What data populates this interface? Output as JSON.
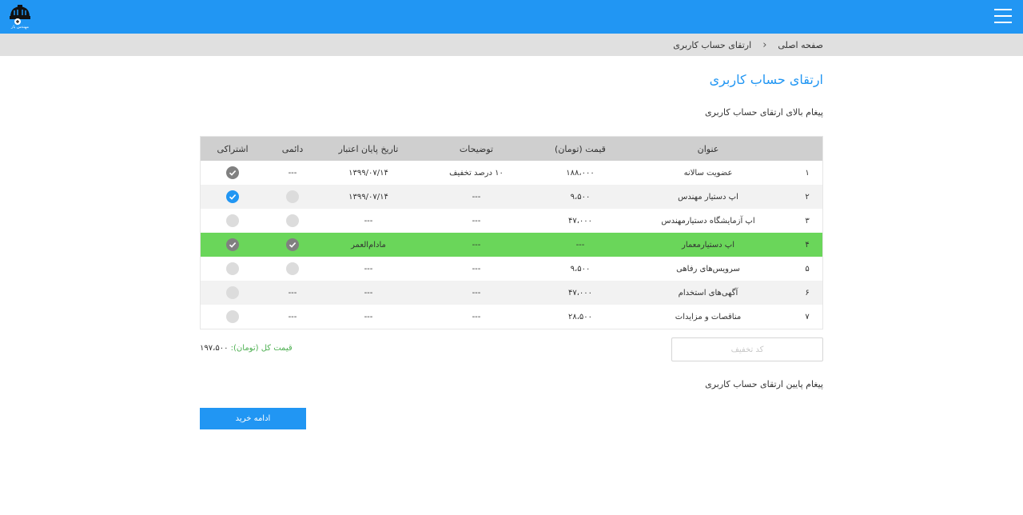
{
  "header": {
    "logo_text": "مهندس یار",
    "menu_icon": "hamburger-icon",
    "accent_color": "#2196f3"
  },
  "breadcrumb": {
    "home": "صفحه اصلی",
    "current": "ارتقای حساب کاربری"
  },
  "page": {
    "title": "ارتقای حساب کاربری",
    "top_message": "پیغام بالای ارتقای حساب کاربری",
    "bottom_message": "پیغام پایین ارتقای حساب کاربری"
  },
  "table": {
    "headers": {
      "title": "عنوان",
      "price": "قیمت (تومان)",
      "desc": "توضیحات",
      "date": "تاریخ پایان اعتبار",
      "permanent": "دائمی",
      "subscription": "اشتراکی"
    },
    "rows": [
      {
        "num": "۱",
        "title": "عضویت سالانه",
        "price": "۱۸۸،۰۰۰",
        "desc": "۱۰ درصد تخفیف",
        "date": "۱۳۹۹/۰۷/۱۴",
        "permanent": "---",
        "subscription": "checked-gray",
        "active": false
      },
      {
        "num": "۲",
        "title": "اپ دستیار مهندس",
        "price": "۹،۵۰۰",
        "desc": "---",
        "date": "۱۳۹۹/۰۷/۱۴",
        "permanent": "off",
        "subscription": "checked-blue",
        "active": false
      },
      {
        "num": "۳",
        "title": "اپ آزمایشگاه دستیارمهندس",
        "price": "۴۷،۰۰۰",
        "desc": "---",
        "date": "---",
        "permanent": "off",
        "subscription": "off",
        "active": false
      },
      {
        "num": "۴",
        "title": "اپ دستیارمعمار",
        "price": "---",
        "desc": "---",
        "date": "مادام‌العمر",
        "permanent": "checked-gray",
        "subscription": "checked-gray",
        "active": true
      },
      {
        "num": "۵",
        "title": "سرویس‌های رفاهی",
        "price": "۹،۵۰۰",
        "desc": "---",
        "date": "---",
        "permanent": "off",
        "subscription": "off",
        "active": false
      },
      {
        "num": "۶",
        "title": "آگهی‌های استخدام",
        "price": "۴۷،۰۰۰",
        "desc": "---",
        "date": "---",
        "permanent": "---",
        "subscription": "off",
        "active": false
      },
      {
        "num": "۷",
        "title": "مناقصات و مزایدات",
        "price": "۲۸،۵۰۰",
        "desc": "---",
        "date": "---",
        "permanent": "---",
        "subscription": "off",
        "active": false
      }
    ]
  },
  "discount": {
    "placeholder": "کد تخفیف",
    "value": ""
  },
  "total": {
    "label": "قیمت کل (تومان):",
    "value": "۱۹۷،۵۰۰"
  },
  "actions": {
    "continue_label": "ادامه خرید"
  },
  "colors": {
    "active_row": "#6ad65a",
    "checked_blue": "#2196f3",
    "checked_gray": "#808080",
    "unchecked": "#dcdcdc",
    "total_label": "#4caf50"
  }
}
